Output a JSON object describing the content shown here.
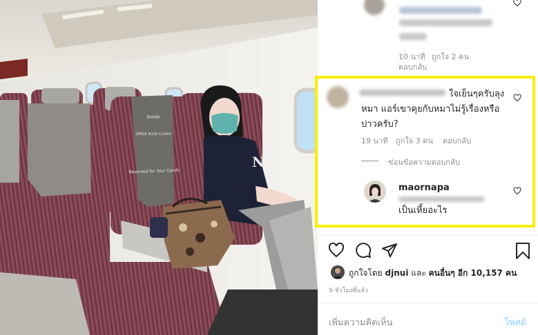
{
  "comment1": {
    "time": "10 นาที",
    "likes": "ถูกใจ 2 คน",
    "reply": "ตอบกลับ"
  },
  "comment2": {
    "text_line1": "ใจเย็นๆครับลุง",
    "text_line2": "หมา แอร์เขาคุยกับหมาไม่รู้เรื่องหรือ",
    "text_line3": "ปาวครับ?",
    "time": "19 นาที",
    "likes": "ถูกใจ 3 คน",
    "reply": "ตอบกลับ",
    "hide_replies": "ซ่อนข้อความตอบกลับ"
  },
  "reply1": {
    "username": "maornapa",
    "text": "เป็นเหี้ยอะไร"
  },
  "likes_summary": {
    "prefix": "ถูกใจโดย",
    "user": "djnui",
    "and": "และ",
    "others": "คนอื่นๆ อีก 10,157 คน"
  },
  "post_time": "9 ชั่วโมงที่แล้ว",
  "add_comment": {
    "placeholder": "เพิ่มความคิดเห็น",
    "post_label": "โพสต์"
  },
  "photo": {
    "seat_headrest_text_1": "Smile",
    "seat_headrest_text_2": "SMILE PLUS CLASS",
    "seat_headrest_text_3": "Reserved for Your Comfort",
    "shirt_logo": "N"
  },
  "colors": {
    "highlight": "#f7f000",
    "link": "#0095f6",
    "seat_fabric": "#7a3a4a"
  }
}
